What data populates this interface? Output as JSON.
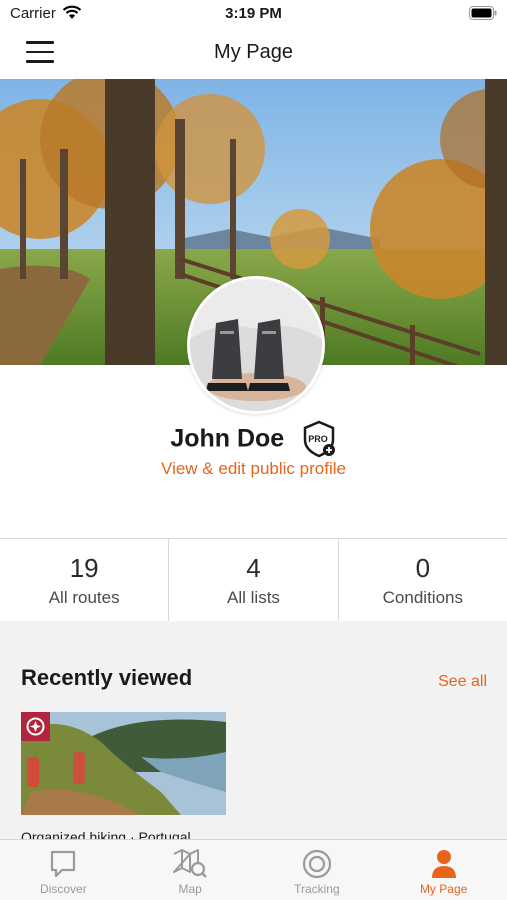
{
  "status_bar": {
    "carrier": "Carrier",
    "time": "3:19 PM"
  },
  "nav": {
    "title": "My Page",
    "menu_icon": "hamburger-menu-icon"
  },
  "profile": {
    "name": "John Doe",
    "badge_text": "PRO",
    "edit_link": "View & edit public profile"
  },
  "stats": [
    {
      "value": "19",
      "label": "All routes"
    },
    {
      "value": "4",
      "label": "All lists"
    },
    {
      "value": "0",
      "label": "Conditions"
    }
  ],
  "recent": {
    "title": "Recently viewed",
    "see_all": "See all",
    "card_caption": "Organized hiking · Portugal"
  },
  "tabs": [
    {
      "label": "Discover",
      "icon": "chat-bubble-icon",
      "active": false
    },
    {
      "label": "Map",
      "icon": "map-search-icon",
      "active": false
    },
    {
      "label": "Tracking",
      "icon": "target-icon",
      "active": false
    },
    {
      "label": "My Page",
      "icon": "person-icon",
      "active": true
    }
  ],
  "colors": {
    "accent": "#e8641b",
    "flag": "#b0263f",
    "tab_inactive": "#9a9a9a"
  }
}
